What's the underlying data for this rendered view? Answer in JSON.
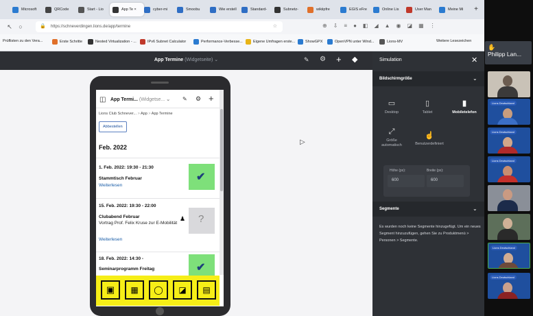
{
  "browser": {
    "tabs": [
      {
        "label": "Microsoft",
        "color": "#2b7bd0",
        "active": false
      },
      {
        "label": "QRCode",
        "color": "#444444",
        "active": false
      },
      {
        "label": "Start - Lio",
        "color": "#555555",
        "active": false
      },
      {
        "label": "App Te ×",
        "color": "#333333",
        "active": true
      },
      {
        "label": "cyber-mi",
        "color": "#2f6ec4",
        "active": false
      },
      {
        "label": "Smoobu",
        "color": "#2f6ec4",
        "active": false
      },
      {
        "label": "Wie erstell",
        "color": "#2f6ec4",
        "active": false
      },
      {
        "label": "Standard-",
        "color": "#2f6ec4",
        "active": false
      },
      {
        "label": "Subnetz-",
        "color": "#333333",
        "active": false
      },
      {
        "label": "wikiipfre",
        "color": "#e0702a",
        "active": false
      },
      {
        "label": "EGIS eFre",
        "color": "#2b7bd0",
        "active": false
      },
      {
        "label": "Online Lis",
        "color": "#2b7bd0",
        "active": false
      },
      {
        "label": "User Man",
        "color": "#c0392b",
        "active": false
      },
      {
        "label": "Meine Mi",
        "color": "#2b7bd0",
        "active": false
      }
    ],
    "url": "https://schneverdingen.lions.de/app/termine",
    "bookmarks": [
      {
        "label": "Prüflisten zu den Vera...",
        "color": "#888888"
      },
      {
        "label": "Erste Schritte",
        "color": "#e0702a"
      },
      {
        "label": "Nested Virtualization - ...",
        "color": "#333333"
      },
      {
        "label": "IPv6 Subnet Calculator",
        "color": "#c0392b"
      },
      {
        "label": "Performance-Verbesse...",
        "color": "#2b7bd0"
      },
      {
        "label": "Eigene Umfragen erste...",
        "color": "#e8b417"
      },
      {
        "label": "ShowGPX",
        "color": "#2b7bd0"
      },
      {
        "label": "OpenVPN unter Wind...",
        "color": "#2b7bd0"
      },
      {
        "label": "Lions-MV",
        "color": "#555555"
      },
      {
        "label": "Weitere Lesezeichen",
        "color": "#888888"
      }
    ]
  },
  "app": {
    "title": "App Termine",
    "title_sub": "(Widgetseite)"
  },
  "phone": {
    "header_title": "App Termi...",
    "header_sub": "(Widgetse...",
    "breadcrumb": [
      "Lions Club Schnever...",
      "App",
      "App Termine"
    ],
    "unsubscribe_label": "Abbestellen",
    "month": "Feb. 2022",
    "events": [
      {
        "date": "1. Feb. 2022: 19:30 - 21:30",
        "title": "Stammtisch Februar",
        "desc": "",
        "link": "Weiterlesen",
        "status": "yes"
      },
      {
        "date": "15. Feb. 2022: 19:30 - 22:00",
        "title": "Clubabend Februar",
        "desc": "Vortrag Prof. Felix Kruse zur E-Mobilität",
        "link": "Weiterlesen",
        "status": "maybe"
      },
      {
        "date": "18. Feb. 2022: 14:30 -",
        "title": "Seminarprogramm Freitag",
        "desc": "",
        "link": "",
        "status": "yes"
      }
    ],
    "nav_icons": [
      "contacts-icon",
      "calendar-icon",
      "chat-icon",
      "gallery-icon",
      "document-icon"
    ],
    "accent": "#f6ee17"
  },
  "simulation": {
    "title": "Simulation",
    "screen_size_header": "Bildschirmgröße",
    "devices": [
      "Desktop",
      "Tablet",
      "Mobiletelefon"
    ],
    "size_modes": [
      "Größe automatisch",
      "Benutzerdefiniert"
    ],
    "height_label": "Höhe (px):",
    "width_label": "Breite (px):",
    "height_value": "600",
    "width_value": "600",
    "segments_header": "Segmente",
    "segments_text": "Es wurden noch keine Segmente hinzugefügt. Um ein neues Segment hinzuzufügen, gehen Sie zu Produktmenü > Personen > Segmente."
  },
  "video": {
    "main_name": "Philipp Lan...",
    "badges": [
      "Lions Deutschland",
      "Lions Deutschland",
      "Lions Deutschland",
      "Lions Deutschland",
      "Lions Deutschland"
    ]
  }
}
